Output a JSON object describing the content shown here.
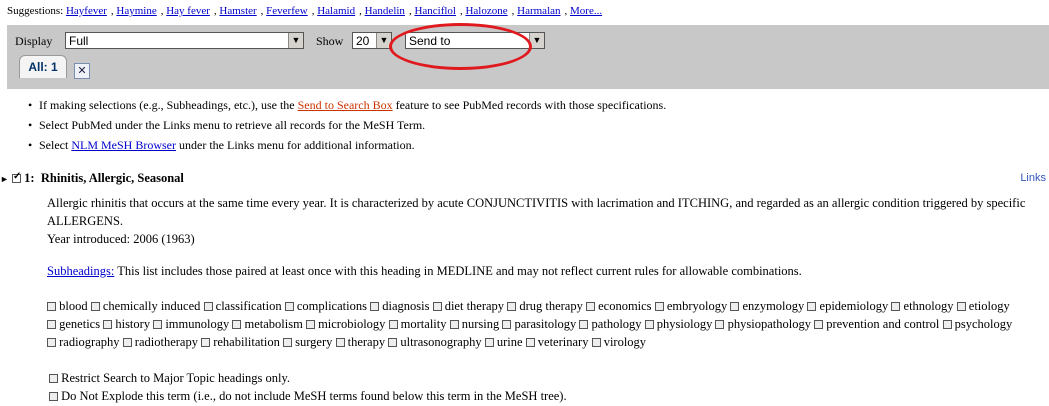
{
  "suggestions": {
    "label": "Suggestions:",
    "items": [
      "Hayfever",
      "Haymine",
      "Hay fever",
      "Hamster",
      "Feverfew",
      "Halamid",
      "Handelin",
      "Hanciflol",
      "Halozone",
      "Harmalan",
      "More..."
    ]
  },
  "toolbar": {
    "display_label": "Display",
    "display_value": "Full",
    "show_label": "Show",
    "show_value": "20",
    "sendto_value": "Send to",
    "tab_all": "All: 1"
  },
  "tips": [
    {
      "before": "If making selections (e.g., Subheadings, etc.), use the ",
      "link": "Send to Search Box",
      "after": " feature to see PubMed records with those specifications."
    },
    {
      "before": "Select PubMed under the Links menu to retrieve all records for the MeSH Term.",
      "link": "",
      "after": ""
    },
    {
      "before": "Select ",
      "link": "NLM MeSH Browser",
      "after": " under the Links menu for additional information."
    }
  ],
  "entry": {
    "number": "1:",
    "title": "Rhinitis, Allergic, Seasonal",
    "links_label": "Links",
    "description": "Allergic rhinitis that occurs at the same time every year. It is characterized by acute CONJUNCTIVITIS with lacrimation and ITCHING, and regarded as an allergic condition triggered by specific ALLERGENS.",
    "year_introduced": "Year introduced: 2006 (1963)",
    "subheadings_link": "Subheadings:",
    "subheadings_text": " This list includes those paired at least once with this heading in MEDLINE and may not reflect current rules for allowable combinations.",
    "subheadings": [
      "blood",
      "chemically induced",
      "classification",
      "complications",
      "diagnosis",
      "diet therapy",
      "drug therapy",
      "economics",
      "embryology",
      "enzymology",
      "epidemiology",
      "ethnology",
      "etiology",
      "genetics",
      "history",
      "immunology",
      "metabolism",
      "microbiology",
      "mortality",
      "nursing",
      "parasitology",
      "pathology",
      "physiology",
      "physiopathology",
      "prevention and control",
      "psychology",
      "radiography",
      "radiotherapy",
      "rehabilitation",
      "surgery",
      "therapy",
      "ultrasonography",
      "urine",
      "veterinary",
      "virology"
    ],
    "restrict_major": "Restrict Search to Major Topic headings only.",
    "no_explode": "Do Not Explode this term (i.e., do not include MeSH terms found below this term in the MeSH tree)."
  },
  "colors": {
    "highlight_circle": "#e0191e",
    "toolbar_bg": "#c8c8c8",
    "link": "#0000cc",
    "link_visited_red": "#cc3300"
  }
}
